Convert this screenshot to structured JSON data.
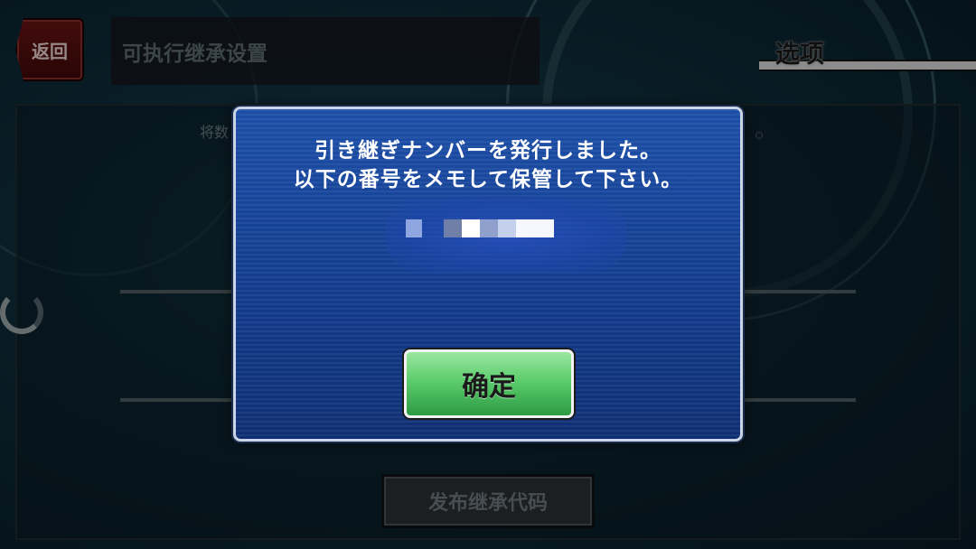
{
  "header": {
    "back_label": "返回",
    "title": "可执行继承设置",
    "options_label": "选项"
  },
  "background": {
    "caption": "将数",
    "issue_button_label": "发布继承代码"
  },
  "dialog": {
    "message_line1": "引き継ぎナンバーを発行しました。",
    "message_line2": "以下の番号をメモして保管して下さい。",
    "code_redacted": true,
    "confirm_label": "确定"
  },
  "colors": {
    "dialog_bg": "#1d4fa8",
    "confirm_button": "#5ccd6c",
    "back_button": "#6a1414"
  }
}
